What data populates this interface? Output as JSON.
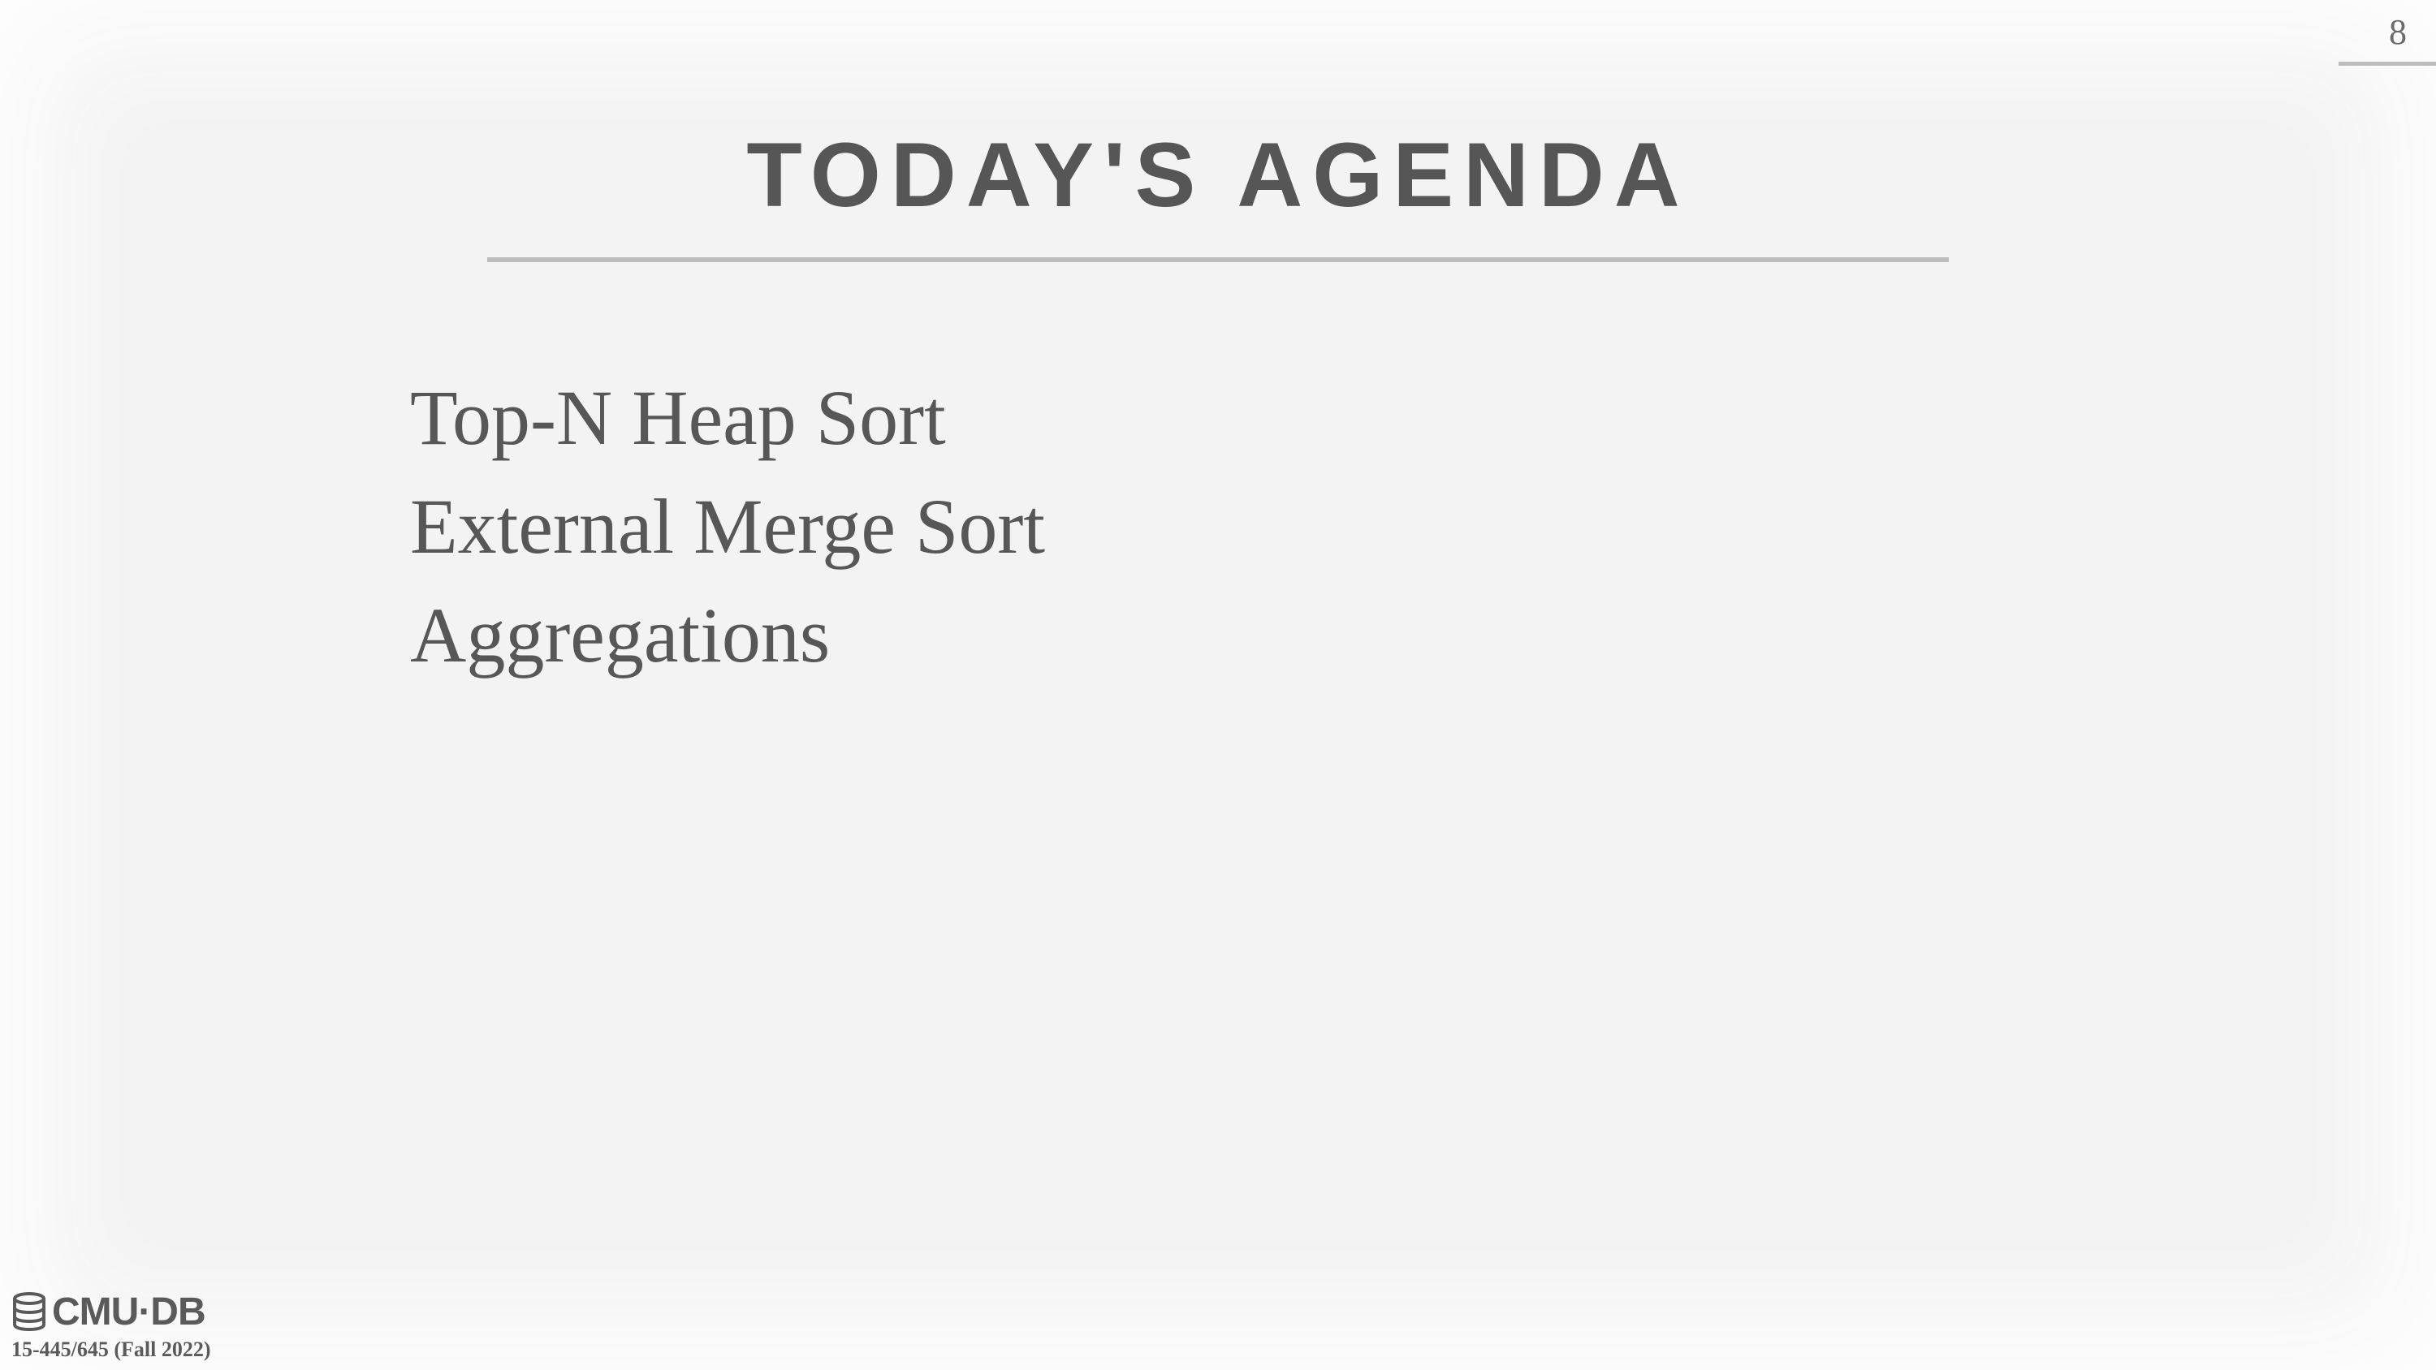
{
  "slide": {
    "page_number": "8",
    "title": "TODAY'S AGENDA",
    "agenda_items": [
      "Top-N Heap Sort",
      "External Merge Sort",
      "Aggregations"
    ]
  },
  "footer": {
    "logo_icon": "database-icon",
    "logo_text": "CMU·DB",
    "course_code": "15-445/645 (Fall 2022)"
  },
  "colors": {
    "background": "#f3f3f3",
    "text": "#575757",
    "rule": "#bdbdbd"
  }
}
